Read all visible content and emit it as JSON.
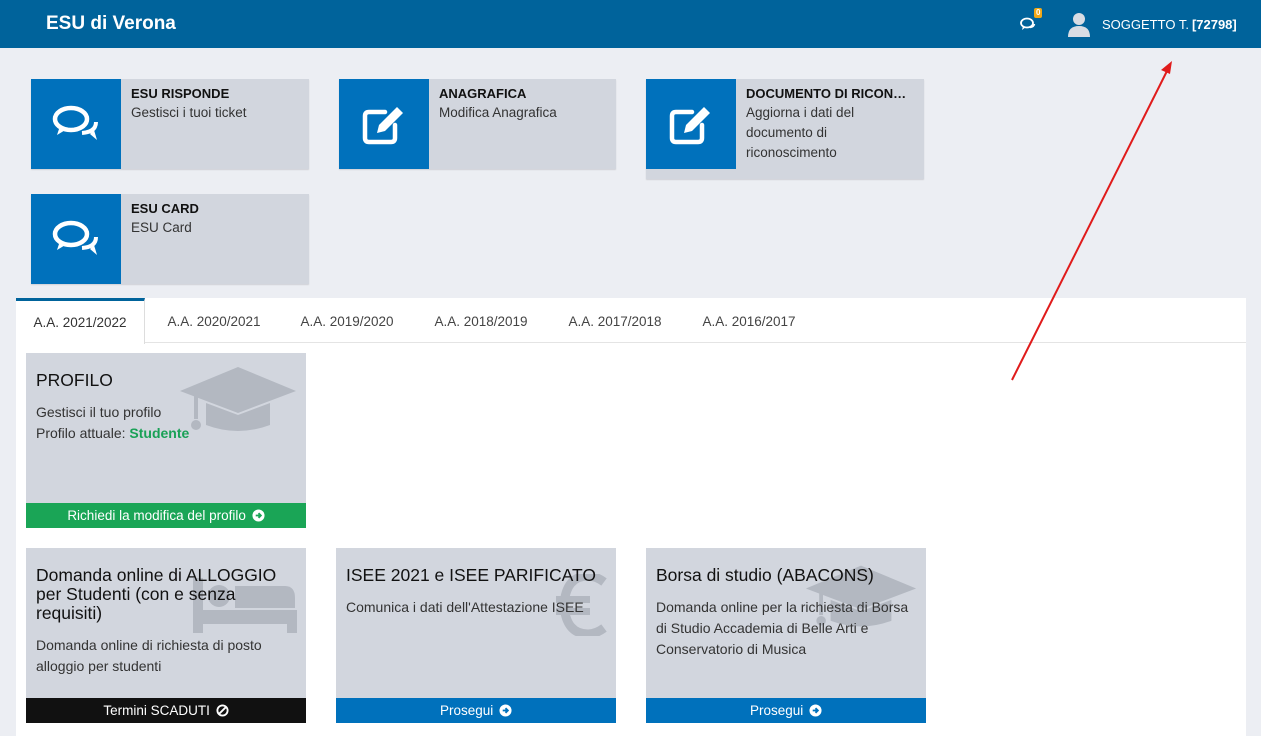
{
  "header": {
    "brand": "ESU di Verona",
    "notifications_count": "0",
    "user_name": "SOGGETTO T.",
    "user_id": "[72798]"
  },
  "shortcuts": [
    {
      "title": "ESU RISPONDE",
      "description": "Gestisci i tuoi ticket",
      "icon": "chat-bubbles-icon"
    },
    {
      "title": "ANAGRAFICA",
      "description": "Modifica Anagrafica",
      "icon": "edit-square-icon"
    },
    {
      "title": "DOCUMENTO DI RICONOSCIMENTO",
      "description": "Aggiorna i dati del documento di riconoscimento",
      "icon": "edit-square-icon"
    },
    {
      "title": "ESU CARD",
      "description": "ESU Card",
      "icon": "chat-bubbles-icon"
    }
  ],
  "tabs": [
    "A.A. 2021/2022",
    "A.A. 2020/2021",
    "A.A. 2019/2020",
    "A.A. 2018/2019",
    "A.A. 2017/2018",
    "A.A. 2016/2017"
  ],
  "profile_card": {
    "title": "PROFILO",
    "line1": "Gestisci il tuo profilo",
    "line2_label": "Profilo attuale:",
    "line2_value": "Studente",
    "footer": "Richiedi la modifica del profilo",
    "icon": "graduation-cap-icon"
  },
  "service_cards": [
    {
      "title": "Domanda online di ALLOGGIO per Studenti (con e senza requisiti)",
      "body": "Domanda online di richiesta di posto alloggio per studenti",
      "footer": "Termini SCADUTI",
      "icon": "bed-icon"
    },
    {
      "title": "ISEE 2021 e ISEE PARIFICATO",
      "body": "Comunica i dati dell'Attestazione ISEE",
      "footer": "Prosegui",
      "icon": "euro-icon"
    },
    {
      "title": "Borsa di studio (ABACONS)",
      "body": "Domanda online per la richiesta di Borsa di Studio Accademia di Belle Arti e Conservatorio di Musica",
      "footer": "Prosegui",
      "icon": "graduation-cap-icon"
    }
  ],
  "colors": {
    "header_bg": "#00639b",
    "tile_icon_bg": "#0071bc",
    "card_bg": "#d2d6de",
    "profile_footer": "#1aa556",
    "expired_footer": "#111111",
    "continue_footer": "#0071bc",
    "annotation_arrow": "#e01b1b"
  }
}
